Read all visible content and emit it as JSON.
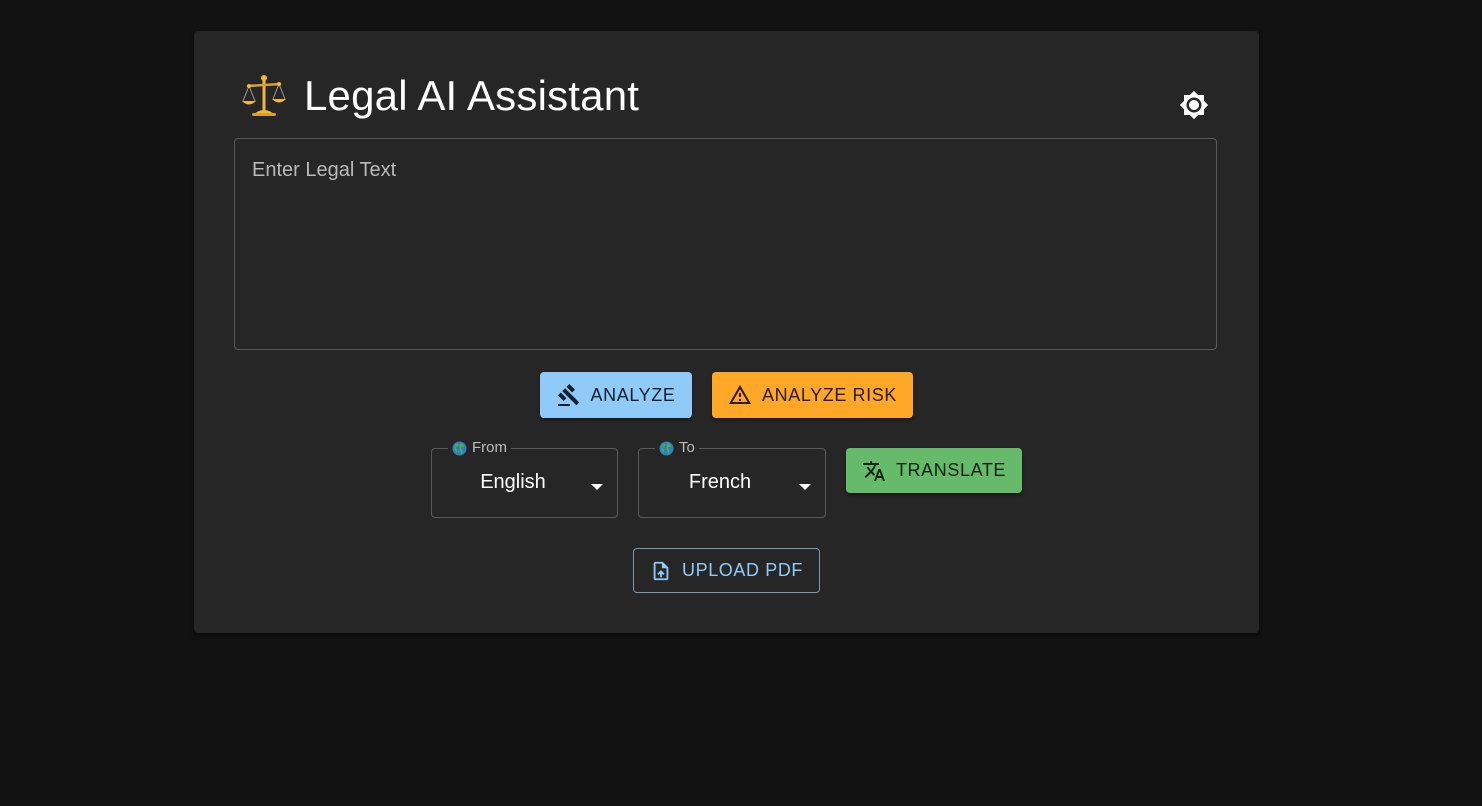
{
  "app": {
    "title": "Legal AI Assistant",
    "title_icon": "scales-icon"
  },
  "theme_toggle": {
    "icon": "brightness-icon"
  },
  "editor": {
    "placeholder": "Enter Legal Text",
    "value": ""
  },
  "actions": {
    "analyze_label": "ANALYZE",
    "analyze_icon": "gavel-icon",
    "analyze_risk_label": "ANALYZE RISK",
    "analyze_risk_icon": "warning-icon"
  },
  "translation": {
    "from": {
      "label": "From",
      "icon": "globe-icon",
      "value": "English"
    },
    "to": {
      "label": "To",
      "icon": "globe-icon",
      "value": "French"
    },
    "translate_label": "TRANSLATE",
    "translate_icon": "translate-icon"
  },
  "upload": {
    "label": "UPLOAD PDF",
    "icon": "file-upload-icon"
  },
  "colors": {
    "background": "#121212",
    "card": "#262626",
    "analyze": "#90caf9",
    "analyze_risk": "#ffa726",
    "translate": "#66bb6a",
    "upload_text": "#90caf9"
  }
}
